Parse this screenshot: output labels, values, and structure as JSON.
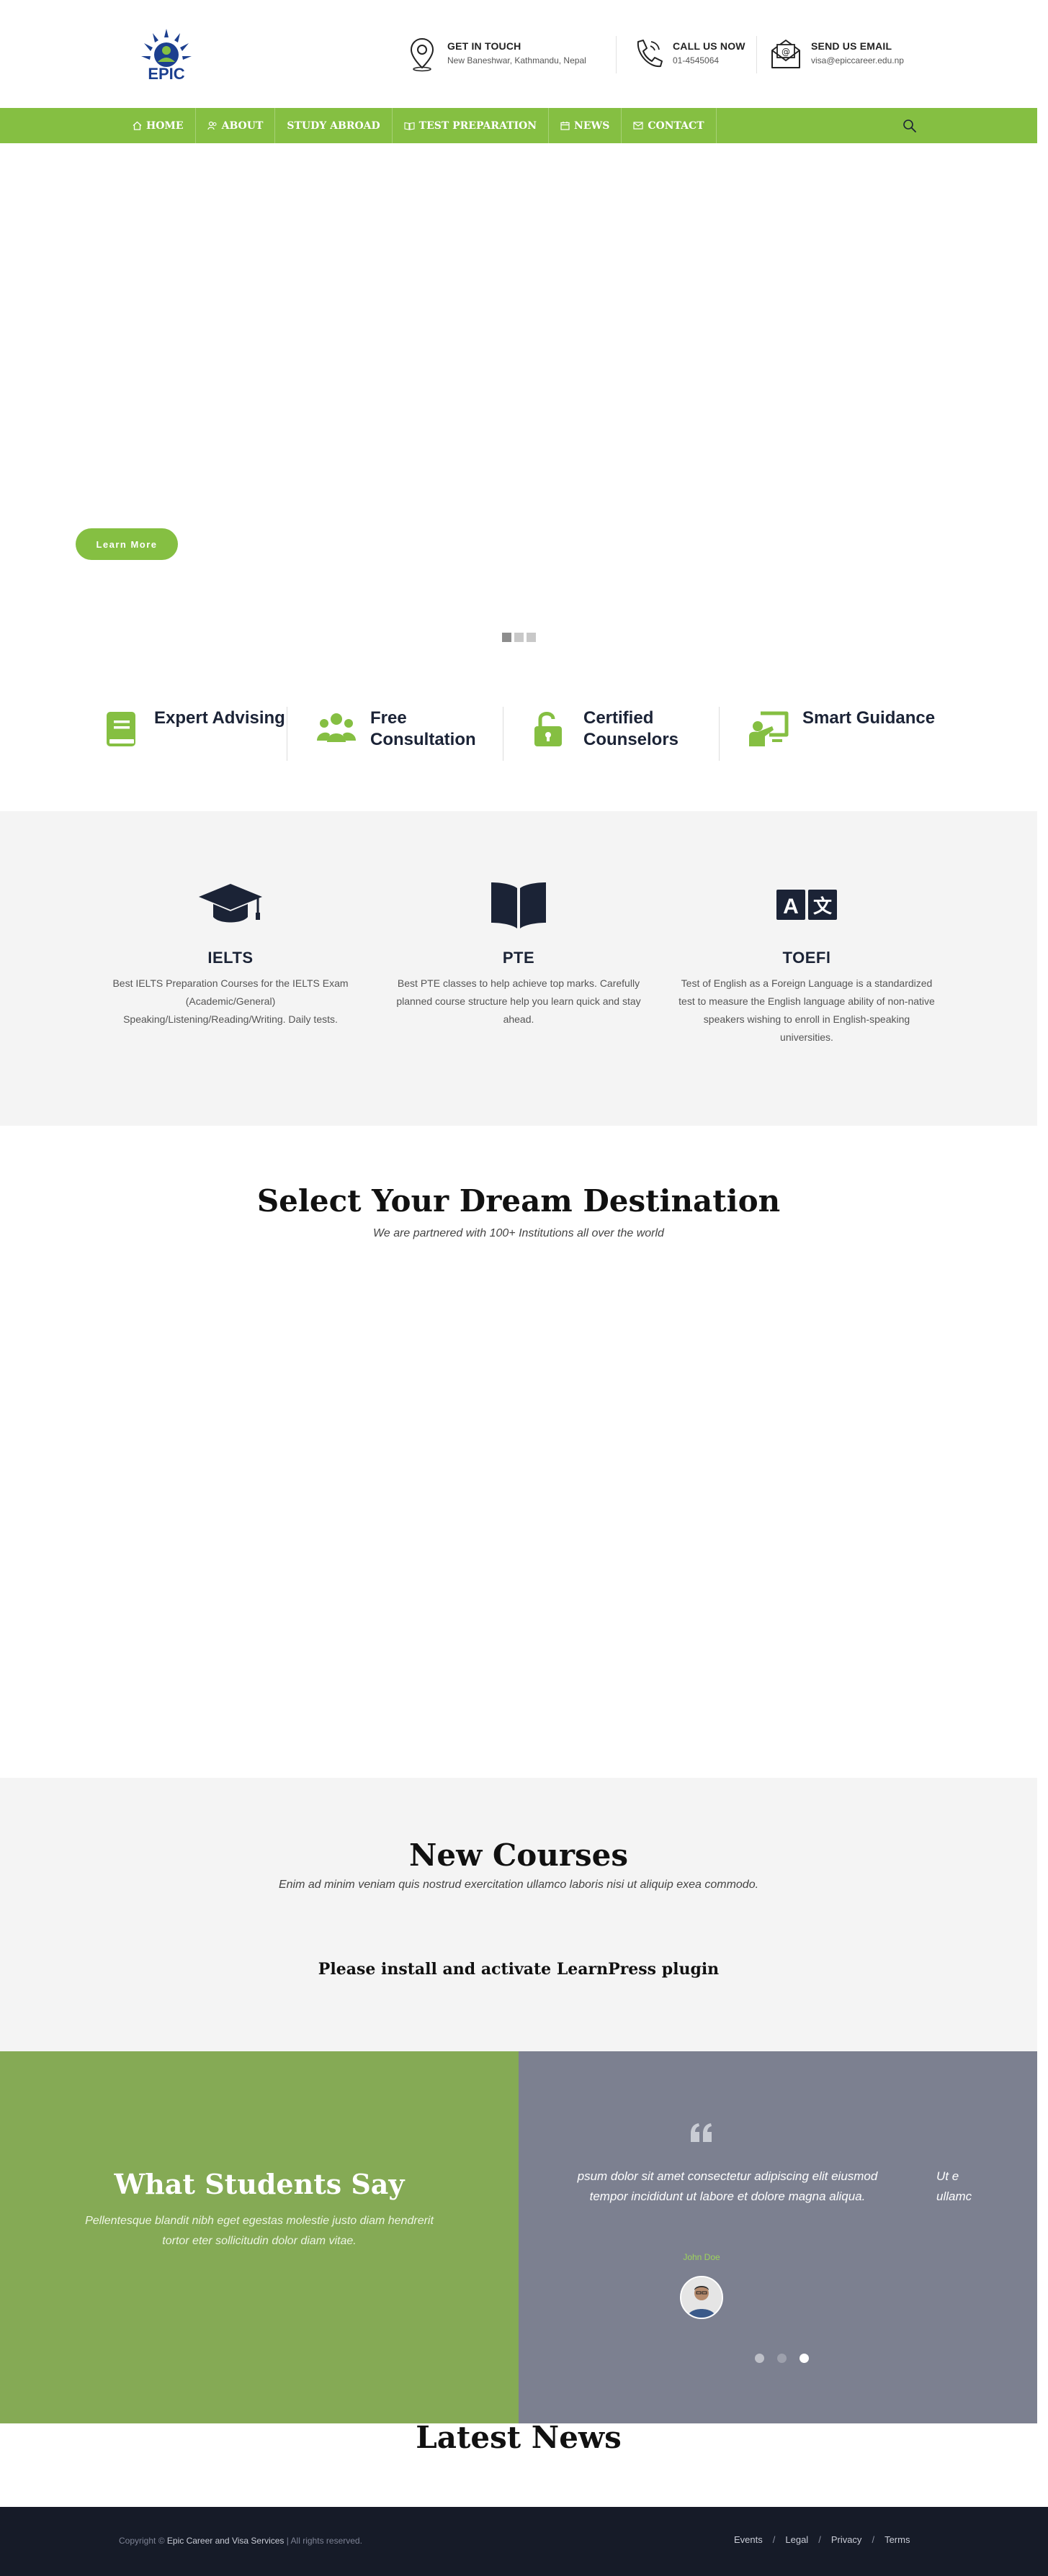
{
  "header": {
    "logo_text": "EPIC",
    "contacts": [
      {
        "icon": "map-pin-icon",
        "title": "GET IN TOUCH",
        "sub": "New Baneshwar, Kathmandu, Nepal"
      },
      {
        "icon": "phone-icon",
        "title": "CALL US NOW",
        "sub": "01-4545064"
      },
      {
        "icon": "envelope-icon",
        "title": "SEND US EMAIL",
        "sub": "visa@epiccareer.edu.np"
      }
    ]
  },
  "nav": {
    "items": [
      {
        "label": "HOME",
        "icon": "home-icon"
      },
      {
        "label": "ABOUT",
        "icon": "users-icon"
      },
      {
        "label": "STUDY ABROAD",
        "icon": ""
      },
      {
        "label": "TEST PREPARATION",
        "icon": "book-icon"
      },
      {
        "label": "NEWS",
        "icon": "calendar-icon"
      },
      {
        "label": "CONTACT",
        "icon": "envelope-icon"
      }
    ],
    "search_icon": "search-icon"
  },
  "hero": {
    "button_label": "Learn More",
    "slides": 3,
    "active_slide": 1
  },
  "features": [
    {
      "icon": "book-icon",
      "title": "Expert Advising"
    },
    {
      "icon": "people-icon",
      "title": "Free Consultation"
    },
    {
      "icon": "unlock-icon",
      "title": "Certified Counselors"
    },
    {
      "icon": "presentation-icon",
      "title": "Smart Guidance"
    }
  ],
  "courses": [
    {
      "icon": "graduation-cap-icon",
      "title": "IELTS",
      "text": "Best IELTS Preparation Courses for the IELTS Exam (Academic/General) Speaking/Listening/Reading/Writing. Daily tests."
    },
    {
      "icon": "open-book-icon",
      "title": "PTE",
      "text": "Best PTE classes to help achieve top marks. Carefully planned course structure help you learn quick and stay ahead."
    },
    {
      "icon": "translate-icon",
      "title": "TOEFl",
      "text": "Test of English as a Foreign Language is a standardized test to measure the English language ability of non-native speakers wishing to enroll in English-speaking universities."
    }
  ],
  "destination": {
    "title": "Select Your Dream Destination",
    "subtitle": "We are partnered with 100+ Institutions all over the world"
  },
  "new_courses": {
    "title": "New Courses",
    "subtitle": "Enim ad minim veniam quis nostrud exercitation ullamco laboris nisi ut aliquip exea commodo.",
    "plugin_message": "Please install and activate LearnPress plugin"
  },
  "testimonials": {
    "title": "What Students Say",
    "subtitle": "Pellentesque blandit nibh eget egestas molestie justo diam hendrerit tortor eter sollicitudin dolor diam vitae.",
    "quote": "psum dolor sit amet consectetur adipiscing elit eiusmod tempor incididunt ut labore et dolore magna aliqua.",
    "next_quote_fragment": "Ut e ullamc",
    "author": "John Doe",
    "dots": 3,
    "active_dot": 3
  },
  "latest_news": {
    "title": "Latest News"
  },
  "footer": {
    "copyright_prefix": "Copyright ©",
    "brand": "Epic Career and Visa Services",
    "copyright_suffix": "| All rights reserved.",
    "links": [
      "Events",
      "Legal",
      "Privacy",
      "Terms"
    ]
  },
  "colors": {
    "accent_green": "#85bf42",
    "navy": "#1b2336",
    "testimonial_green": "#85aa55",
    "testimonial_gray": "#7c8090",
    "footer_bg": "#161b28"
  }
}
